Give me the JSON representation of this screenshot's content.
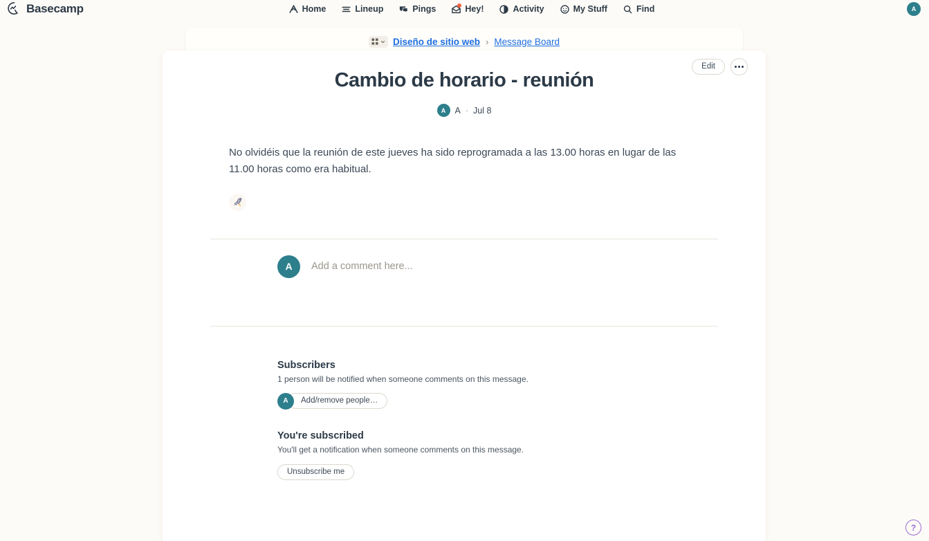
{
  "brand": {
    "name": "Basecamp",
    "logo_icon": "basecamp-logo-icon"
  },
  "nav": {
    "items": [
      {
        "label": "Home",
        "icon": "home-icon"
      },
      {
        "label": "Lineup",
        "icon": "lineup-icon"
      },
      {
        "label": "Pings",
        "icon": "pings-icon"
      },
      {
        "label": "Hey!",
        "icon": "hey-inbox-icon",
        "badge": true
      },
      {
        "label": "Activity",
        "icon": "activity-icon"
      },
      {
        "label": "My Stuff",
        "icon": "smiley-icon"
      },
      {
        "label": "Find",
        "icon": "search-icon"
      }
    ],
    "user_avatar": "A"
  },
  "breadcrumb": {
    "grid_icon": "grid-apps-icon",
    "chevron_icon": "chevron-down-icon",
    "project": "Diseño de sitio web",
    "separator": "›",
    "section": "Message Board"
  },
  "post": {
    "title": "Cambio de horario - reunión",
    "author_avatar": "A",
    "author": "A",
    "meta_separator": "·",
    "date": "Jul 8",
    "body": "No olvidéis que la reunión de este jueves ha sido reprogramada a las 13.00 horas en lugar de las 11.00 horas como era habitual.",
    "edit_label": "Edit",
    "more_label": "•••",
    "boost_icon": "boost-rocket-icon"
  },
  "comment": {
    "avatar": "A",
    "placeholder": "Add a comment here...",
    "value": ""
  },
  "subscribers": {
    "title": "Subscribers",
    "note": "1 person will be notified when someone comments on this message.",
    "avatar": "A",
    "add_remove_label": "Add/remove people…"
  },
  "subscription": {
    "title": "You're subscribed",
    "note": "You'll get a notification when someone comments on this message.",
    "unsubscribe_label": "Unsubscribe me"
  },
  "help": {
    "label": "?"
  },
  "colors": {
    "page_background": "#fdfbf7",
    "card_background": "#ffffff",
    "ink": "#2c3a47",
    "link": "#1f6fe0",
    "avatar_teal": "#2d7f8c",
    "badge_orange": "#f5603f",
    "help_purple": "#9b6bd6",
    "rule": "#eae5dc"
  }
}
